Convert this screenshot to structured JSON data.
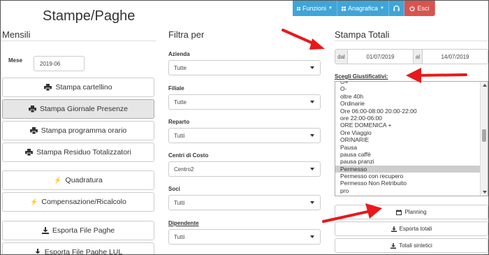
{
  "toolbar": {
    "funzioni": "Funzioni",
    "anagrafica": "Anagrafica",
    "esci": "Esci",
    "accent": "#3fa5d8",
    "danger": "#d9534f"
  },
  "page": {
    "title": "Stampe/Paghe"
  },
  "mensili": {
    "heading": "Mensili",
    "mese_label": "Mese",
    "mese_value": "2019-06",
    "buttons": [
      {
        "label": "Stampa cartellino",
        "icon": "printer-icon"
      },
      {
        "label": "Stampa Giornale Presenze",
        "icon": "printer-icon"
      },
      {
        "label": "Stampa programma orario",
        "icon": "printer-icon"
      },
      {
        "label": "Stampa Residuo Totalizzatori",
        "icon": "printer-icon"
      },
      {
        "label": "Quadratura",
        "icon": "bolt-icon"
      },
      {
        "label": "Compensazione/Ricalcolo",
        "icon": "bolt-icon"
      },
      {
        "label": "Esporta File Paghe",
        "icon": "download-icon"
      },
      {
        "label": "Esporta File Paghe LUL",
        "icon": "download-icon"
      }
    ]
  },
  "filtra": {
    "heading": "Filtra per",
    "fields": [
      {
        "label": "Azienda",
        "value": "Tutte"
      },
      {
        "label": "Filiale",
        "value": "Tutte"
      },
      {
        "label": "Reparto",
        "value": "Tutti"
      },
      {
        "label": "Centri di Costo",
        "value": "Centro2"
      },
      {
        "label": "Soci",
        "value": "Tutti"
      },
      {
        "label": "Dipendente",
        "value": "Tutti"
      }
    ]
  },
  "totali": {
    "heading": "Stampa Totali",
    "dal_label": "dal",
    "dal_value": "01/07/2019",
    "al_label": "al",
    "al_value": "14/07/2019",
    "giust_label": "Scegli Giustificativi:",
    "giustificativi": [
      "O+",
      "O-",
      "oltre 40h",
      "Ordinarie",
      "Ore 06:00-08:00 20:00-22:00",
      "ore 22:00-06:00",
      "ORE DOMENICA +",
      "Ore Viaggio",
      "ORINARIE",
      "Pausa",
      "pausa caffè",
      "pausa pranzi",
      "Permesso",
      "Permesso con recupero",
      "Permesso Non Retribuito",
      "pro"
    ],
    "selected": "Permesso",
    "buttons": [
      {
        "label": "Planning",
        "icon": "calendar-icon"
      },
      {
        "label": "Esporta totali",
        "icon": "download-icon"
      },
      {
        "label": "Totali sintetici",
        "icon": "download-icon"
      }
    ]
  },
  "annotations": {
    "arrow_color": "#e8191a"
  }
}
